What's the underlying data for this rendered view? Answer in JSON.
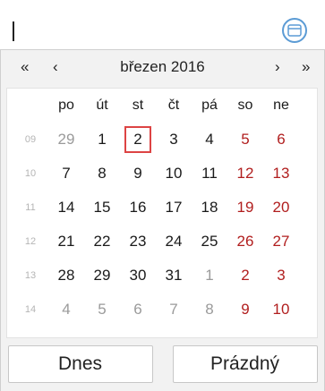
{
  "nav": {
    "prev_year": "«",
    "prev_month": "‹",
    "title": "březen 2016",
    "next_month": "›",
    "next_year": "»"
  },
  "weekday_headers": [
    "po",
    "út",
    "st",
    "čt",
    "pá",
    "so",
    "ne"
  ],
  "weeks": [
    {
      "week": "09",
      "days": [
        "29",
        "1",
        "2",
        "3",
        "4",
        "5",
        "6"
      ]
    },
    {
      "week": "10",
      "days": [
        "7",
        "8",
        "9",
        "10",
        "11",
        "12",
        "13"
      ]
    },
    {
      "week": "11",
      "days": [
        "14",
        "15",
        "16",
        "17",
        "18",
        "19",
        "20"
      ]
    },
    {
      "week": "12",
      "days": [
        "21",
        "22",
        "23",
        "24",
        "25",
        "26",
        "27"
      ]
    },
    {
      "week": "13",
      "days": [
        "28",
        "29",
        "30",
        "31",
        "1",
        "2",
        "3"
      ]
    },
    {
      "week": "14",
      "days": [
        "4",
        "5",
        "6",
        "7",
        "8",
        "9",
        "10"
      ]
    }
  ],
  "buttons": {
    "today": "Dnes",
    "clear": "Prázdný"
  },
  "colors": {
    "weekend": "#b11e1e",
    "today_border": "#dd4444",
    "icon_accent": "#5b9bd5"
  }
}
